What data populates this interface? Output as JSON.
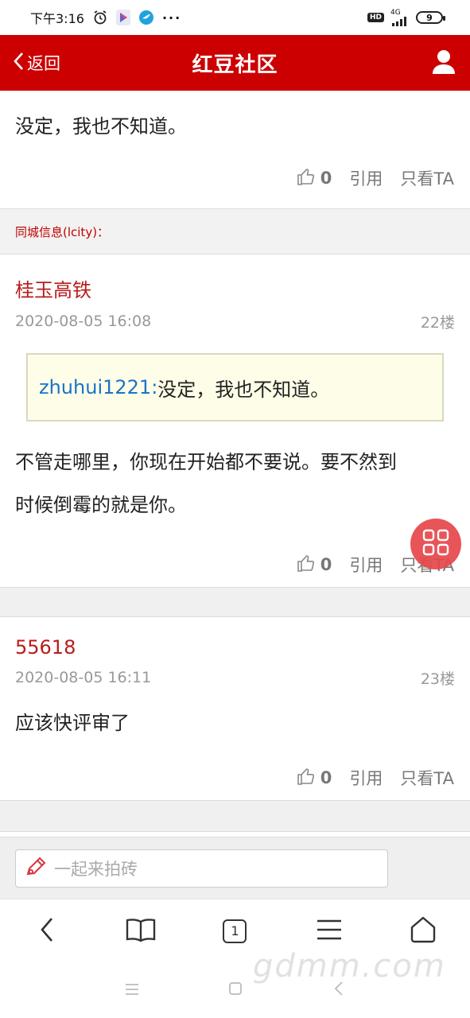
{
  "status_bar": {
    "time": "下午3:16",
    "network": "4G",
    "hd": "HD",
    "battery": "9"
  },
  "header": {
    "back_label": "返回",
    "title": "红豆社区"
  },
  "posts": [
    {
      "text": "没定，我也不知道。",
      "likes": "0",
      "quote_label": "引用",
      "only_label": "只看TA"
    },
    {
      "author": "桂玉高铁",
      "datetime": "2020-08-05 16:08",
      "floor": "22楼",
      "quote_user": "zhuhui1221:",
      "quote_text": "没定，我也不知道。",
      "text_line1": "不管走哪里，你现在开始都不要说。要不然到",
      "text_line2": "时候倒霉的就是你。",
      "likes": "0",
      "quote_label": "引用",
      "only_label": "只看TA"
    },
    {
      "author": "55618",
      "datetime": "2020-08-05 16:11",
      "floor": "23楼",
      "text": "应该快评审了",
      "likes": "0",
      "quote_label": "引用",
      "only_label": "只看TA"
    }
  ],
  "source": "同城信息(lcity)：",
  "reply": {
    "placeholder": "一起来拍砖"
  },
  "browser_nav": {
    "tabs_count": "1"
  },
  "watermark": "gdmm.com",
  "colors": {
    "brand_red": "#cc0000",
    "author_red": "#b81c1c",
    "link_blue": "#1a73c9",
    "quote_bg": "#fefde8"
  }
}
